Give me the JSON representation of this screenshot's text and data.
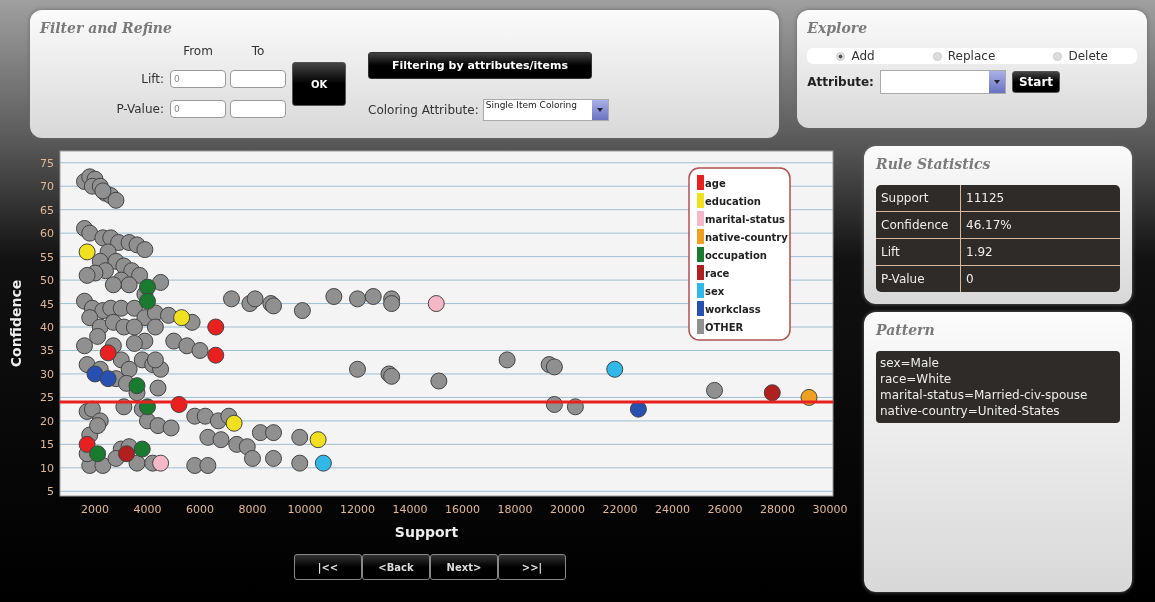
{
  "filter_panel": {
    "title": "Filter and Refine",
    "range_headers": [
      "From",
      "To"
    ],
    "ranges": [
      {
        "label": "Lift:",
        "from": "0"
      },
      {
        "label": "P-Value:",
        "from": "0"
      }
    ],
    "ok_button": "OK",
    "filter_button": "Filtering by attributes/items",
    "coloring": {
      "label": "Coloring Attribute:",
      "value": "Single Item Coloring"
    }
  },
  "explore_panel": {
    "title": "Explore",
    "modes": [
      {
        "label": "Add",
        "selected": true
      },
      {
        "label": "Replace",
        "selected": false
      },
      {
        "label": "Delete",
        "selected": false
      }
    ],
    "attribute_label": "Attribute:",
    "start_button": "Start"
  },
  "chart_data": {
    "type": "scatter",
    "xlabel": "Support",
    "ylabel": "Confidence",
    "xlim": [
      667,
      30114
    ],
    "ylim": [
      4,
      77.5
    ],
    "xticks": [
      2000,
      4000,
      6000,
      8000,
      10000,
      12000,
      14000,
      16000,
      18000,
      20000,
      22000,
      24000,
      26000,
      28000,
      30000
    ],
    "yticks": [
      5,
      10,
      15,
      20,
      25,
      30,
      35,
      40,
      45,
      50,
      55,
      60,
      65,
      70,
      75
    ],
    "series": [
      {
        "name": "age",
        "color": "#e82020",
        "x": [
          2500,
          1700,
          6600,
          6600,
          5200
        ],
        "values": [
          34.5,
          15,
          40,
          34,
          23.5
        ]
      },
      {
        "name": "education",
        "color": "#f0e020",
        "x": [
          1700,
          5300,
          7300,
          10500
        ],
        "values": [
          56,
          42,
          19.5,
          16
        ]
      },
      {
        "name": "marital-status",
        "color": "#f4b8c8",
        "x": [
          4500,
          15000
        ],
        "values": [
          11,
          45
        ]
      },
      {
        "name": "native-country",
        "color": "#f0a020",
        "x": [
          29200
        ],
        "values": [
          25
        ]
      },
      {
        "name": "occupation",
        "color": "#1a7a30",
        "x": [
          4000,
          4000,
          3600,
          4000,
          2100,
          3800
        ],
        "values": [
          48.5,
          45.5,
          27.5,
          23,
          13,
          14
        ]
      },
      {
        "name": "race",
        "color": "#b02020",
        "x": [
          3200,
          27800
        ],
        "values": [
          13,
          26
        ]
      },
      {
        "name": "sex",
        "color": "#30b8e8",
        "x": [
          10700,
          21800
        ],
        "values": [
          11,
          31
        ]
      },
      {
        "name": "workclass",
        "color": "#2850b0",
        "x": [
          2000,
          2500,
          22700
        ],
        "values": [
          30,
          29,
          22.5
        ]
      },
      {
        "name": "OTHER",
        "color": "#909090",
        "x": [
          1600,
          1800,
          2000,
          1900,
          2200,
          2400,
          2600,
          2800,
          2300,
          1600,
          1800,
          2300,
          2600,
          2900,
          3300,
          3600,
          3900,
          2500,
          2200,
          2800,
          3100,
          3400,
          3700,
          2400,
          2000,
          1700,
          3000,
          3300,
          2700,
          4500,
          3900,
          1600,
          1900,
          2300,
          2600,
          3000,
          3500,
          3900,
          4300,
          4800,
          5700,
          1800,
          2200,
          2700,
          3100,
          3500,
          4300,
          3900,
          3500,
          1600,
          2100,
          2700,
          3000,
          3300,
          3800,
          4200,
          4500,
          4300,
          1700,
          2200,
          2800,
          3200,
          3600,
          4400,
          5000,
          5500,
          6000,
          1700,
          1900,
          2200,
          1800,
          2100,
          3100,
          3800,
          4000,
          4400,
          4900,
          5800,
          6200,
          6700,
          7100,
          6300,
          6800,
          7400,
          7800,
          8300,
          8800,
          9800,
          8000,
          8800,
          9800,
          5800,
          6300,
          1800,
          2300,
          3000,
          3300,
          2800,
          3600,
          4200,
          1700,
          7200,
          7900,
          8100,
          8700,
          8800,
          9900,
          11100,
          12000,
          12600,
          13300,
          13300,
          12000,
          13200,
          13300,
          15100,
          17700,
          19300,
          19500,
          19500,
          20300,
          25600
        ],
        "values": [
          71,
          72,
          71.5,
          70,
          70,
          68.5,
          68,
          67,
          69,
          61,
          60,
          59,
          59,
          58,
          58,
          57.5,
          56.5,
          56,
          54,
          54,
          53,
          52,
          51,
          52,
          51.5,
          51,
          50,
          49,
          49,
          49.5,
          47,
          45.5,
          44,
          43.5,
          44,
          44,
          44,
          42,
          43,
          42.5,
          41,
          42,
          40,
          41,
          40,
          40,
          40,
          37,
          36.5,
          36,
          38,
          36,
          33,
          31,
          33,
          32,
          31,
          33,
          32,
          31,
          29,
          28,
          26,
          27,
          37,
          36,
          35,
          22,
          22.5,
          20,
          17,
          19,
          23,
          22.5,
          20,
          19,
          18.5,
          21,
          21,
          20,
          21,
          16.5,
          16,
          15,
          14.5,
          17.5,
          17.5,
          16.5,
          12,
          12,
          11,
          10.5,
          10.5,
          10.5,
          10.5,
          14,
          14.5,
          12,
          11,
          11,
          13,
          46,
          45,
          46,
          45,
          44.5,
          43.5,
          46.5,
          46,
          46.5,
          46,
          45,
          31,
          30,
          29.5,
          28.5,
          33,
          32,
          31.5,
          23.5,
          23,
          26.5
        ]
      }
    ],
    "ref_lines": [
      {
        "axis": "y",
        "value": 24
      }
    ],
    "grid": true,
    "legend": "upper right"
  },
  "rule_statistics": {
    "title": "Rule Statistics",
    "rows": [
      {
        "name": "Support",
        "value": "11125"
      },
      {
        "name": "Confidence",
        "value": "46.17%"
      },
      {
        "name": "Lift",
        "value": "1.92"
      },
      {
        "name": "P-Value",
        "value": "0"
      }
    ]
  },
  "pattern": {
    "title": "Pattern",
    "lines": [
      "sex=Male",
      "race=White",
      "marital-status=Married-civ-spouse",
      "native-country=United-States"
    ]
  },
  "navigation": [
    "|<<",
    "<Back",
    "Next>",
    ">>|"
  ]
}
